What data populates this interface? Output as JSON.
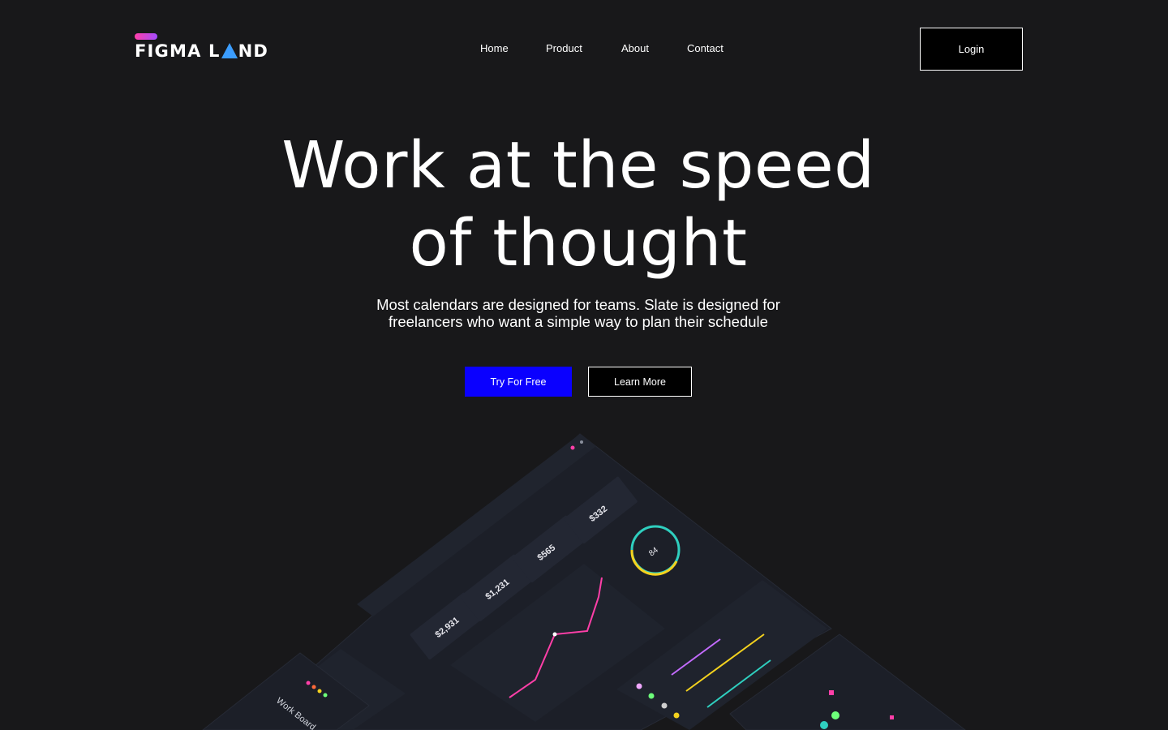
{
  "header": {
    "logo_text": "FIGMA LAND",
    "logo_part1": "FIGMA L",
    "logo_part2": "ND",
    "nav": [
      "Home",
      "Product",
      "About",
      "Contact"
    ],
    "login_label": "Login"
  },
  "hero": {
    "title_line1": "Work at the speed",
    "title_line2": "of thought",
    "subtitle_line1": "Most calendars are designed for teams. Slate is designed for",
    "subtitle_line2": "freelancers who want a simple way to plan their schedule",
    "primary_cta": "Try For Free",
    "secondary_cta": "Learn More"
  },
  "showcase": {
    "stat_1": "$2,931",
    "stat_2": "$1,231",
    "stat_3": "$565",
    "stat_4": "$332",
    "donut_value": "84",
    "work_board_title": "Work Board"
  },
  "colors": {
    "background": "#18181a",
    "primary_button": "#0a00ff",
    "accent_pink": "#ff3fa8",
    "accent_purple": "#a24cff",
    "logo_triangle": "#3b9dff"
  }
}
